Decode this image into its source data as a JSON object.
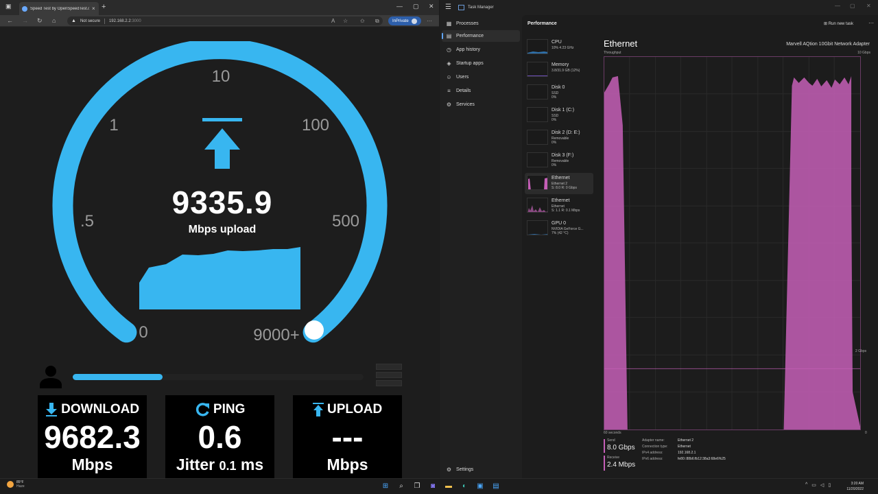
{
  "browser": {
    "tab_title": "Speed Test by OpenSpeedTest.com",
    "tab_close": "×",
    "new_tab": "+",
    "security_label": "Not secure",
    "url_host": "192.168.2.2",
    "url_port": ":3000",
    "inprivate_label": "InPrivate",
    "more_label": "···"
  },
  "gauge": {
    "ticks": [
      "0",
      ".5",
      "1",
      "10",
      "100",
      "500",
      "9000+"
    ],
    "value": "9335.9",
    "unit": "Mbps upload",
    "accent_color": "#38b6f0"
  },
  "progress": {
    "fraction": 0.31
  },
  "cards": {
    "download": {
      "label": "DOWNLOAD",
      "value": "9682.3",
      "unit": "Mbps"
    },
    "ping": {
      "label": "PING",
      "value": "0.6",
      "jitter_label": "Jitter",
      "jitter_value": "0.1",
      "unit": "ms"
    },
    "upload": {
      "label": "UPLOAD",
      "value": "---",
      "unit": "Mbps"
    }
  },
  "taskmanager": {
    "title": "Task Manager",
    "nav": [
      {
        "label": "Processes",
        "icon": "grid-icon"
      },
      {
        "label": "Performance",
        "icon": "pulse-icon"
      },
      {
        "label": "App history",
        "icon": "history-icon"
      },
      {
        "label": "Startup apps",
        "icon": "rocket-icon"
      },
      {
        "label": "Users",
        "icon": "users-icon"
      },
      {
        "label": "Details",
        "icon": "list-icon"
      },
      {
        "label": "Services",
        "icon": "puzzle-icon"
      }
    ],
    "settings_label": "Settings",
    "header": "Performance",
    "run_task": "Run new task",
    "devices": [
      {
        "name": "CPU",
        "s1": "10% 4.23 GHz",
        "s2": ""
      },
      {
        "name": "Memory",
        "s1": "3.8/31.9 GB (12%)",
        "s2": ""
      },
      {
        "name": "Disk 0",
        "s1": "SSD",
        "s2": "0%"
      },
      {
        "name": "Disk 1 (C:)",
        "s1": "SSD",
        "s2": "0%"
      },
      {
        "name": "Disk 2 (D: E:)",
        "s1": "Removable",
        "s2": "0%"
      },
      {
        "name": "Disk 3 (F:)",
        "s1": "Removable",
        "s2": "0%"
      },
      {
        "name": "Ethernet",
        "s1": "Ethernet 2",
        "s2": "S: 8.0 R: 0 Gbps"
      },
      {
        "name": "Ethernet",
        "s1": "Ethernet",
        "s2": "S: 1.1 R: 0.1 Mbps"
      },
      {
        "name": "GPU 0",
        "s1": "NVIDIA GeForce G...",
        "s2": "7% (42 °C)"
      }
    ],
    "detail": {
      "title": "Ethernet",
      "adapter": "Marvell AQtion 10Gbit Network Adapter",
      "throughput_label": "Throughput",
      "max_label": "10 Gbps",
      "mid_label": "2 Gbps",
      "time_label": "60 seconds",
      "zero_label": "0",
      "send_label": "Send",
      "send_value": "8.0 Gbps",
      "receive_label": "Receive",
      "receive_value": "2.4 Mbps",
      "properties": [
        {
          "k": "Adapter name:",
          "v": "Ethernet 2"
        },
        {
          "k": "Connection type:",
          "v": "Ethernet"
        },
        {
          "k": "IPv4 address:",
          "v": "192.168.2.1"
        },
        {
          "k": "IPv6 address:",
          "v": "fe80::88b6:fb12:38a3:68e6%25"
        }
      ],
      "graph_color": "#c55fb7"
    }
  },
  "taskbar": {
    "temp": "85°F",
    "condition": "Haze",
    "time": "3:20 AM",
    "date": "11/20/2022"
  }
}
